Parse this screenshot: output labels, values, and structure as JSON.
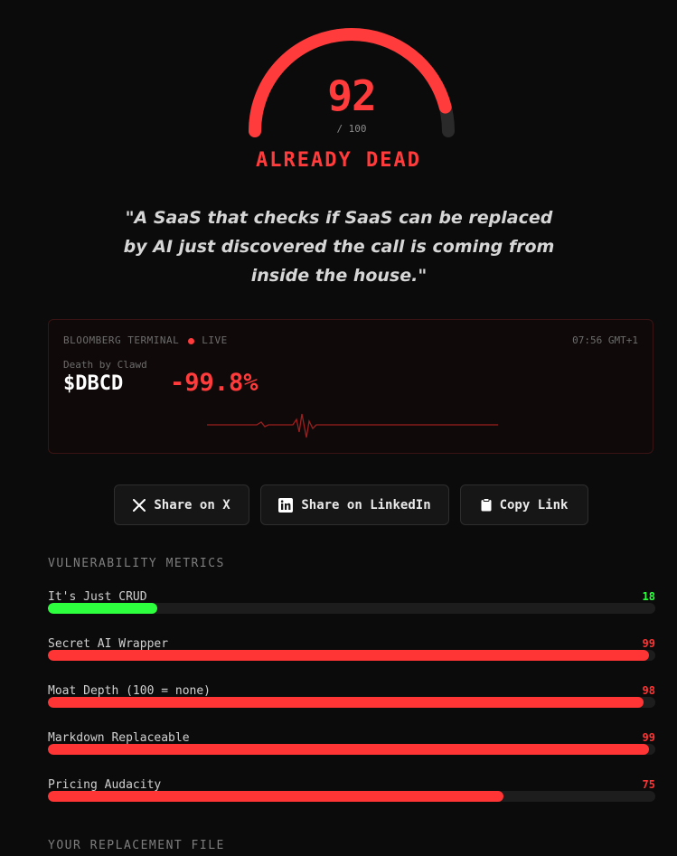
{
  "score": {
    "value": "92",
    "max_label": "/ 100",
    "fraction": 0.92,
    "verdict": "ALREADY DEAD"
  },
  "quote": "\"A SaaS that checks if SaaS can be replaced by AI just discovered the call is coming from inside the house.\"",
  "terminal": {
    "title": "BLOOMBERG TERMINAL",
    "live_label": "LIVE",
    "time": "07:56 GMT+1",
    "company": "Death by Clawd",
    "ticker": "$DBCD",
    "change": "-99.8%"
  },
  "share": {
    "x_label": "Share on X",
    "linkedin_label": "Share on LinkedIn",
    "copy_label": "Copy Link"
  },
  "metrics_title": "VULNERABILITY METRICS",
  "metrics": [
    {
      "label": "It's Just CRUD",
      "value": 18,
      "value_label": "18",
      "color": "#2dff3f"
    },
    {
      "label": "Secret AI Wrapper",
      "value": 99,
      "value_label": "99",
      "color": "#ff3434"
    },
    {
      "label": "Moat Depth (100 = none)",
      "value": 98,
      "value_label": "98",
      "color": "#ff3434"
    },
    {
      "label": "Markdown Replaceable",
      "value": 99,
      "value_label": "99",
      "color": "#ff3434"
    },
    {
      "label": "Pricing Audacity",
      "value": 75,
      "value_label": "75",
      "color": "#ff3434"
    }
  ],
  "replacement_title": "YOUR REPLACEMENT FILE",
  "colors": {
    "accent": "#ff3b3b",
    "safe": "#2dff3f",
    "background": "#0b0b0b"
  }
}
